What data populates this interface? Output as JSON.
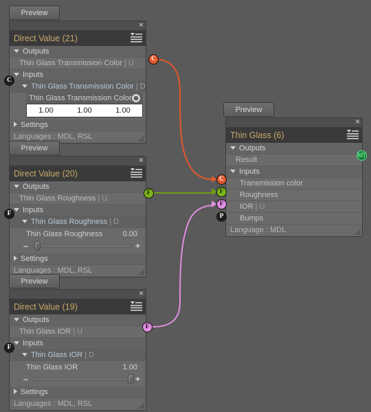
{
  "app": {
    "background_color": "#5a5a5a",
    "canvas_name": "node-graph-canvas"
  },
  "labels": {
    "preview": "Preview",
    "outputs": "Outputs",
    "inputs": "Inputs",
    "settings": "Settings",
    "close": "×"
  },
  "nodes": [
    {
      "id": "direct-value-21",
      "title": "Direct Value (21)",
      "preview_label": "Preview",
      "outputs_label": "Outputs",
      "inputs_label": "Inputs",
      "settings_label": "Settings",
      "output_port": {
        "label": "Thin Glass Transmission Color",
        "suffix": "| U",
        "letter": "C",
        "color": "#e2572b"
      },
      "input_port": {
        "label": "Thin Glass Transmission Color",
        "suffix": "| D",
        "letter": "C",
        "color": "#1e1e1e"
      },
      "value_label": "Thin Glass Transmission Color",
      "value_components": [
        "1.00",
        "1.00",
        "1.00"
      ],
      "footer": "Languages : MDL, RSL"
    },
    {
      "id": "direct-value-20",
      "title": "Direct Value (20)",
      "preview_label": "Preview",
      "outputs_label": "Outputs",
      "inputs_label": "Inputs",
      "settings_label": "Settings",
      "output_port": {
        "label": "Thin Glass Roughness",
        "suffix": "| U",
        "letter": "F",
        "color": "#7cb518"
      },
      "input_port": {
        "label": "Thin Glass Roughness",
        "suffix": "| D",
        "letter": "F",
        "color": "#1e1e1e"
      },
      "value_label": "Thin Glass Roughness",
      "value": "0.00",
      "slider_percent": 3,
      "footer": "Languages : MDL, RSL"
    },
    {
      "id": "direct-value-19",
      "title": "Direct Value (19)",
      "preview_label": "Preview",
      "outputs_label": "Outputs",
      "inputs_label": "Inputs",
      "settings_label": "Settings",
      "output_port": {
        "label": "Thin Glass IOR",
        "suffix": "| U",
        "letter": "F",
        "color": "#e08fe0"
      },
      "input_port": {
        "label": "Thin Glass IOR",
        "suffix": "| D",
        "letter": "F",
        "color": "#1e1e1e"
      },
      "value_label": "Thin Glass IOR",
      "value": "1.00",
      "slider_percent": 97,
      "footer": "Languages : MDL, RSL"
    },
    {
      "id": "thin-glass-6",
      "title": "Thin Glass (6)",
      "preview_label": "Preview",
      "outputs_label": "Outputs",
      "inputs_label": "Inputs",
      "output_port": {
        "label": "Result",
        "letter": "MT",
        "color": "#1f7a3d"
      },
      "input_ports": [
        {
          "label": "Transmission color",
          "suffix": "",
          "letter": "C",
          "color": "#e2572b",
          "connected": true
        },
        {
          "label": "Roughness",
          "suffix": "",
          "letter": "F",
          "color": "#7cb518",
          "connected": true
        },
        {
          "label": "IOR",
          "suffix": "| U",
          "letter": "F",
          "color": "#e08fe0",
          "connected": true
        },
        {
          "label": "Bumps",
          "suffix": "",
          "letter": "P",
          "color": "#1e1e1e",
          "connected": false
        }
      ],
      "footer": "Language : MDL"
    }
  ],
  "connections": [
    {
      "name": "transmission-color-wire",
      "from": "Thin Glass Transmission Color",
      "to": "Transmission color",
      "color": "#e2572b"
    },
    {
      "name": "roughness-wire",
      "from": "Thin Glass Roughness",
      "to": "Roughness",
      "color": "#7cb518"
    },
    {
      "name": "ior-wire",
      "from": "Thin Glass IOR",
      "to": "IOR",
      "color": "#e08fe0"
    }
  ]
}
